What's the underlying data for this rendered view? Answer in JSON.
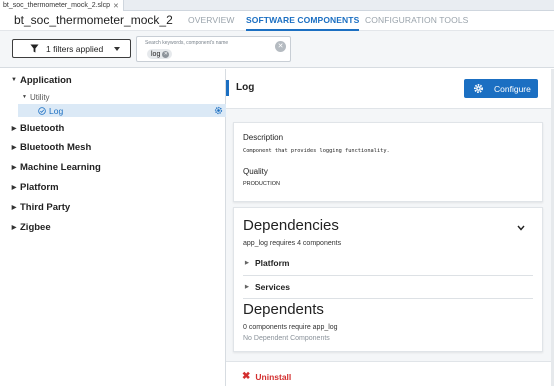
{
  "editor_tab": {
    "filename": "bt_soc_thermometer_mock_2.slcp",
    "close": "✕"
  },
  "header": {
    "project_title": "bt_soc_thermometer_mock_2",
    "tabs": [
      {
        "label": "OVERVIEW",
        "active": false
      },
      {
        "label": "SOFTWARE COMPONENTS",
        "active": true
      },
      {
        "label": "CONFIGURATION TOOLS",
        "active": false
      }
    ]
  },
  "filterbar": {
    "filter_button_label": "1 filters applied",
    "search_placeholder": "Search keywords, component's name",
    "search_chip": "log",
    "funnel_icon": "funnel-icon",
    "clear_icon": "clear-circle-icon"
  },
  "tree": {
    "categories": [
      {
        "label": "Application",
        "expanded": true
      },
      {
        "label": "Bluetooth",
        "expanded": false
      },
      {
        "label": "Bluetooth Mesh",
        "expanded": false
      },
      {
        "label": "Machine Learning",
        "expanded": false
      },
      {
        "label": "Platform",
        "expanded": false
      },
      {
        "label": "Third Party",
        "expanded": false
      },
      {
        "label": "Zigbee",
        "expanded": false
      }
    ],
    "subgroup": "Utility",
    "selected_leaf": "Log"
  },
  "component": {
    "name": "Log",
    "configure_label": "Configure",
    "description_label": "Description",
    "description": "Component that provides logging functionality.",
    "quality_label": "Quality",
    "quality": "PRODUCTION"
  },
  "dependencies": {
    "title": "Dependencies",
    "summary": "app_log requires 4 components",
    "groups": [
      "Platform",
      "Services"
    ]
  },
  "dependents": {
    "title": "Dependents",
    "summary": "0 components require app_log",
    "empty_text": "No Dependent Components"
  },
  "footer": {
    "uninstall_label": "Uninstall"
  },
  "colors": {
    "accent": "#1b6fc2",
    "danger": "#d32f2f",
    "selected_row": "#dbe9f6"
  }
}
